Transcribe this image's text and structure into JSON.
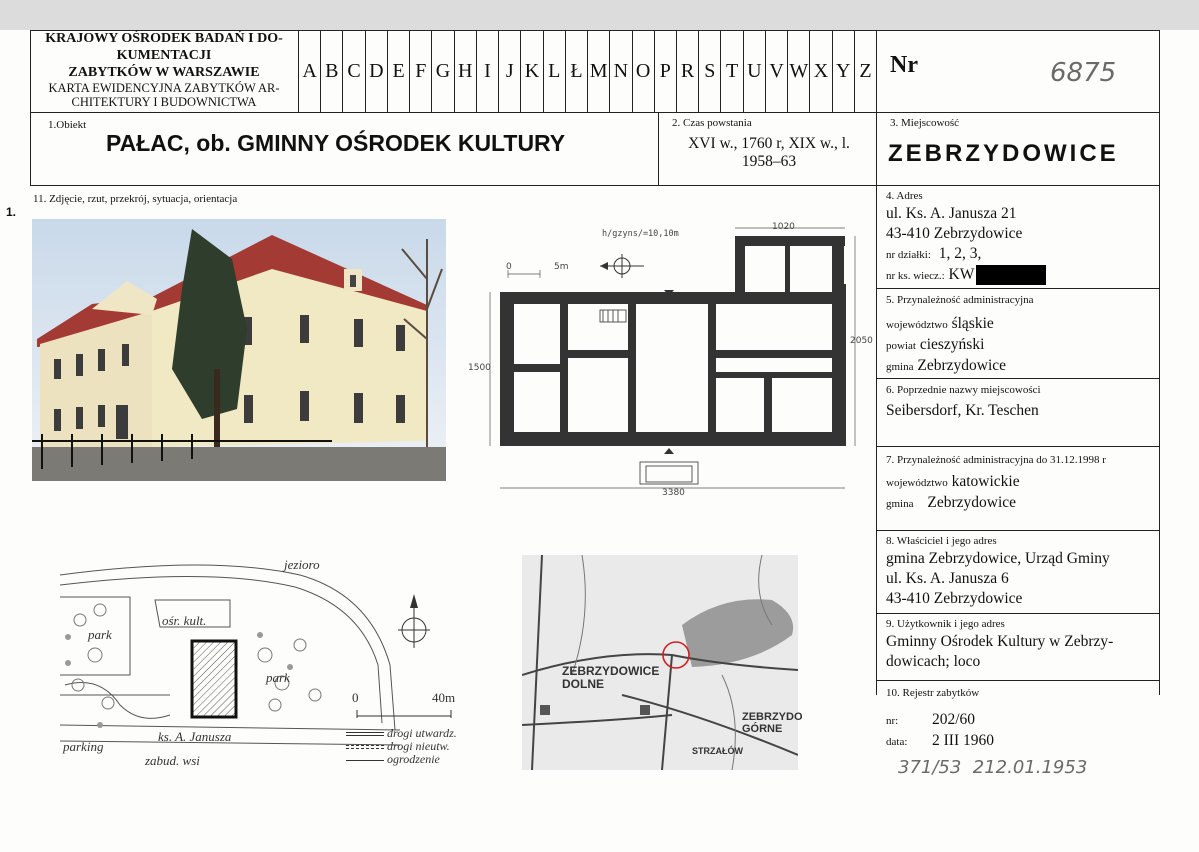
{
  "header": {
    "institution_line1": "KRAJOWY OŚRODEK BADAŃ I DO-",
    "institution_line2": "KUMENTACJI",
    "institution_line3": "ZABYTKÓW W WARSZAWIE",
    "card_line1": "KARTA EWIDENCYJNA ZABYTKÓW AR-",
    "card_line2": "CHITEKTURY I BUDOWNICTWA",
    "letters": [
      "A",
      "B",
      "C",
      "D",
      "E",
      "F",
      "G",
      "H",
      "I",
      "J",
      "K",
      "L",
      "Ł",
      "M",
      "N",
      "O",
      "P",
      "R",
      "S",
      "T",
      "U",
      "V",
      "W",
      "X",
      "Y",
      "Z"
    ],
    "nr_label": "Nr",
    "nr_value": "6875"
  },
  "object": {
    "label": "1.Obiekt",
    "value": "PAŁAC, ob. GMINNY OŚRODEK KULTURY"
  },
  "period": {
    "label": "2. Czas powstania",
    "value_line1": "XVI w., 1760 r, XIX w., l.",
    "value_line2": "1958–63"
  },
  "locality": {
    "label": "3. Miejscowość",
    "value": "ZEBRZYDOWICE"
  },
  "photos": {
    "label": "11. Zdjęcie, rzut, przekrój, sytuacja, orientacja",
    "number": "1."
  },
  "floorplan": {
    "height_note": "h/gzyns/=10,10m",
    "dim_top": "1020",
    "dim_left": "1500",
    "dim_right": "2050",
    "dim_bottom": "3380",
    "scale_zero": "0",
    "scale_end": "5m"
  },
  "siteplan": {
    "lake": "jezioro",
    "park1": "park",
    "park2": "park",
    "culture_house": "ośr. kult.",
    "street": "ks. A. Janusza",
    "parking": "parking",
    "village": "zabud. wsi",
    "scale_zero": "0",
    "scale_end": "40m",
    "legend": [
      "drogi utwardz.",
      "drogi nieutw.",
      "ogrodzenie"
    ]
  },
  "locmap": {
    "label1_line1": "ZEBRZYDOWICE",
    "label1_line2": "DOLNE",
    "label2_line1": "ZEBRZYDO",
    "label2_line2": "GÓRNE",
    "label3": "STRZAŁÓW"
  },
  "address": {
    "label": "4. Adres",
    "line1": "ul. Ks. A. Janusza 21",
    "line2": "43-410 Zebrzydowice",
    "plot_label": "nr działki:",
    "plot_value": "1, 2, 3,",
    "kw_label": "nr ks. wiecz.:",
    "kw_value": "KW"
  },
  "admin": {
    "label": "5. Przynależność administracyjna",
    "voiv_label": "województwo",
    "voiv_value": "śląskie",
    "county_label": "powiat",
    "county_value": "cieszyński",
    "commune_label": "gmina",
    "commune_value": "Zebrzydowice"
  },
  "former_names": {
    "label": "6. Poprzednie nazwy miejscowości",
    "value": "Seibersdorf, Kr. Teschen"
  },
  "admin_1998": {
    "label": "7. Przynależność administracyjna do 31.12.1998 r",
    "voiv_label": "województwo",
    "voiv_value": "katowickie",
    "commune_label": "gmina",
    "commune_value": "Zebrzydowice"
  },
  "owner": {
    "label": "8. Właściciel i jego adres",
    "line1": "gmina Zebrzydowice, Urząd Gminy",
    "line2": "ul. Ks. A. Janusza 6",
    "line3": "43-410 Zebrzydowice"
  },
  "user": {
    "label": "9. Użytkownik i jego adres",
    "line1": "Gminny Ośrodek Kultury w Zebrzy-",
    "line2": "dowicach; loco"
  },
  "register": {
    "label": "10. Rejestr zabytków",
    "nr_label": "nr:",
    "nr_value": "202/60",
    "date_label": "data:",
    "date_value": "2 III 1960",
    "handwritten": "371/53  212.01.1953"
  }
}
